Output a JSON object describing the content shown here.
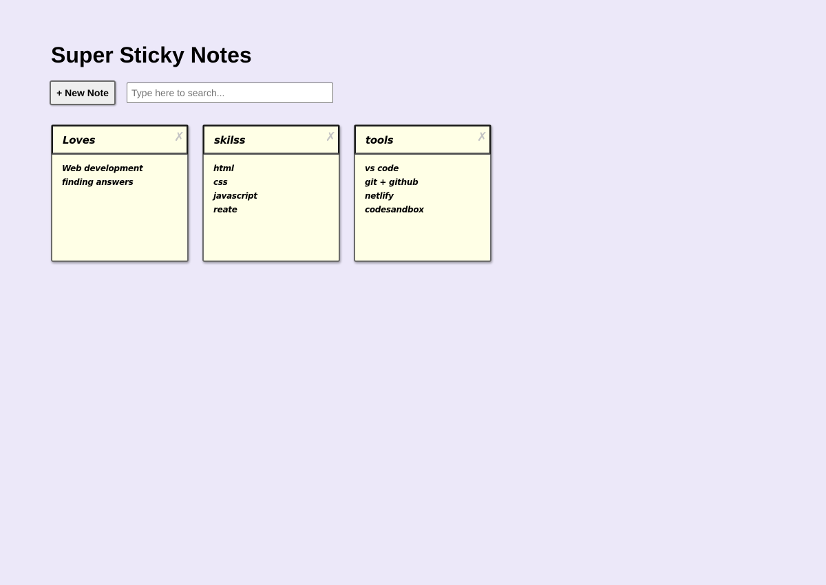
{
  "app": {
    "title": "Super Sticky Notes"
  },
  "controls": {
    "new_note_label": "+ New Note",
    "search": {
      "placeholder": "Type here to search...",
      "value": ""
    }
  },
  "notes": [
    {
      "title": "Loves",
      "close_label": "✗",
      "lines": [
        "Web development",
        "finding answers"
      ]
    },
    {
      "title": "skilss",
      "close_label": "✗",
      "lines": [
        "html",
        "css",
        "javascript",
        "reate"
      ]
    },
    {
      "title": "tools",
      "close_label": "✗",
      "lines": [
        "vs code",
        "git + github",
        "netlify",
        "codesandbox"
      ]
    }
  ],
  "colors": {
    "background": "#ece8f9",
    "note_background": "#ffffe6",
    "close_icon": "#c4c4c4"
  }
}
